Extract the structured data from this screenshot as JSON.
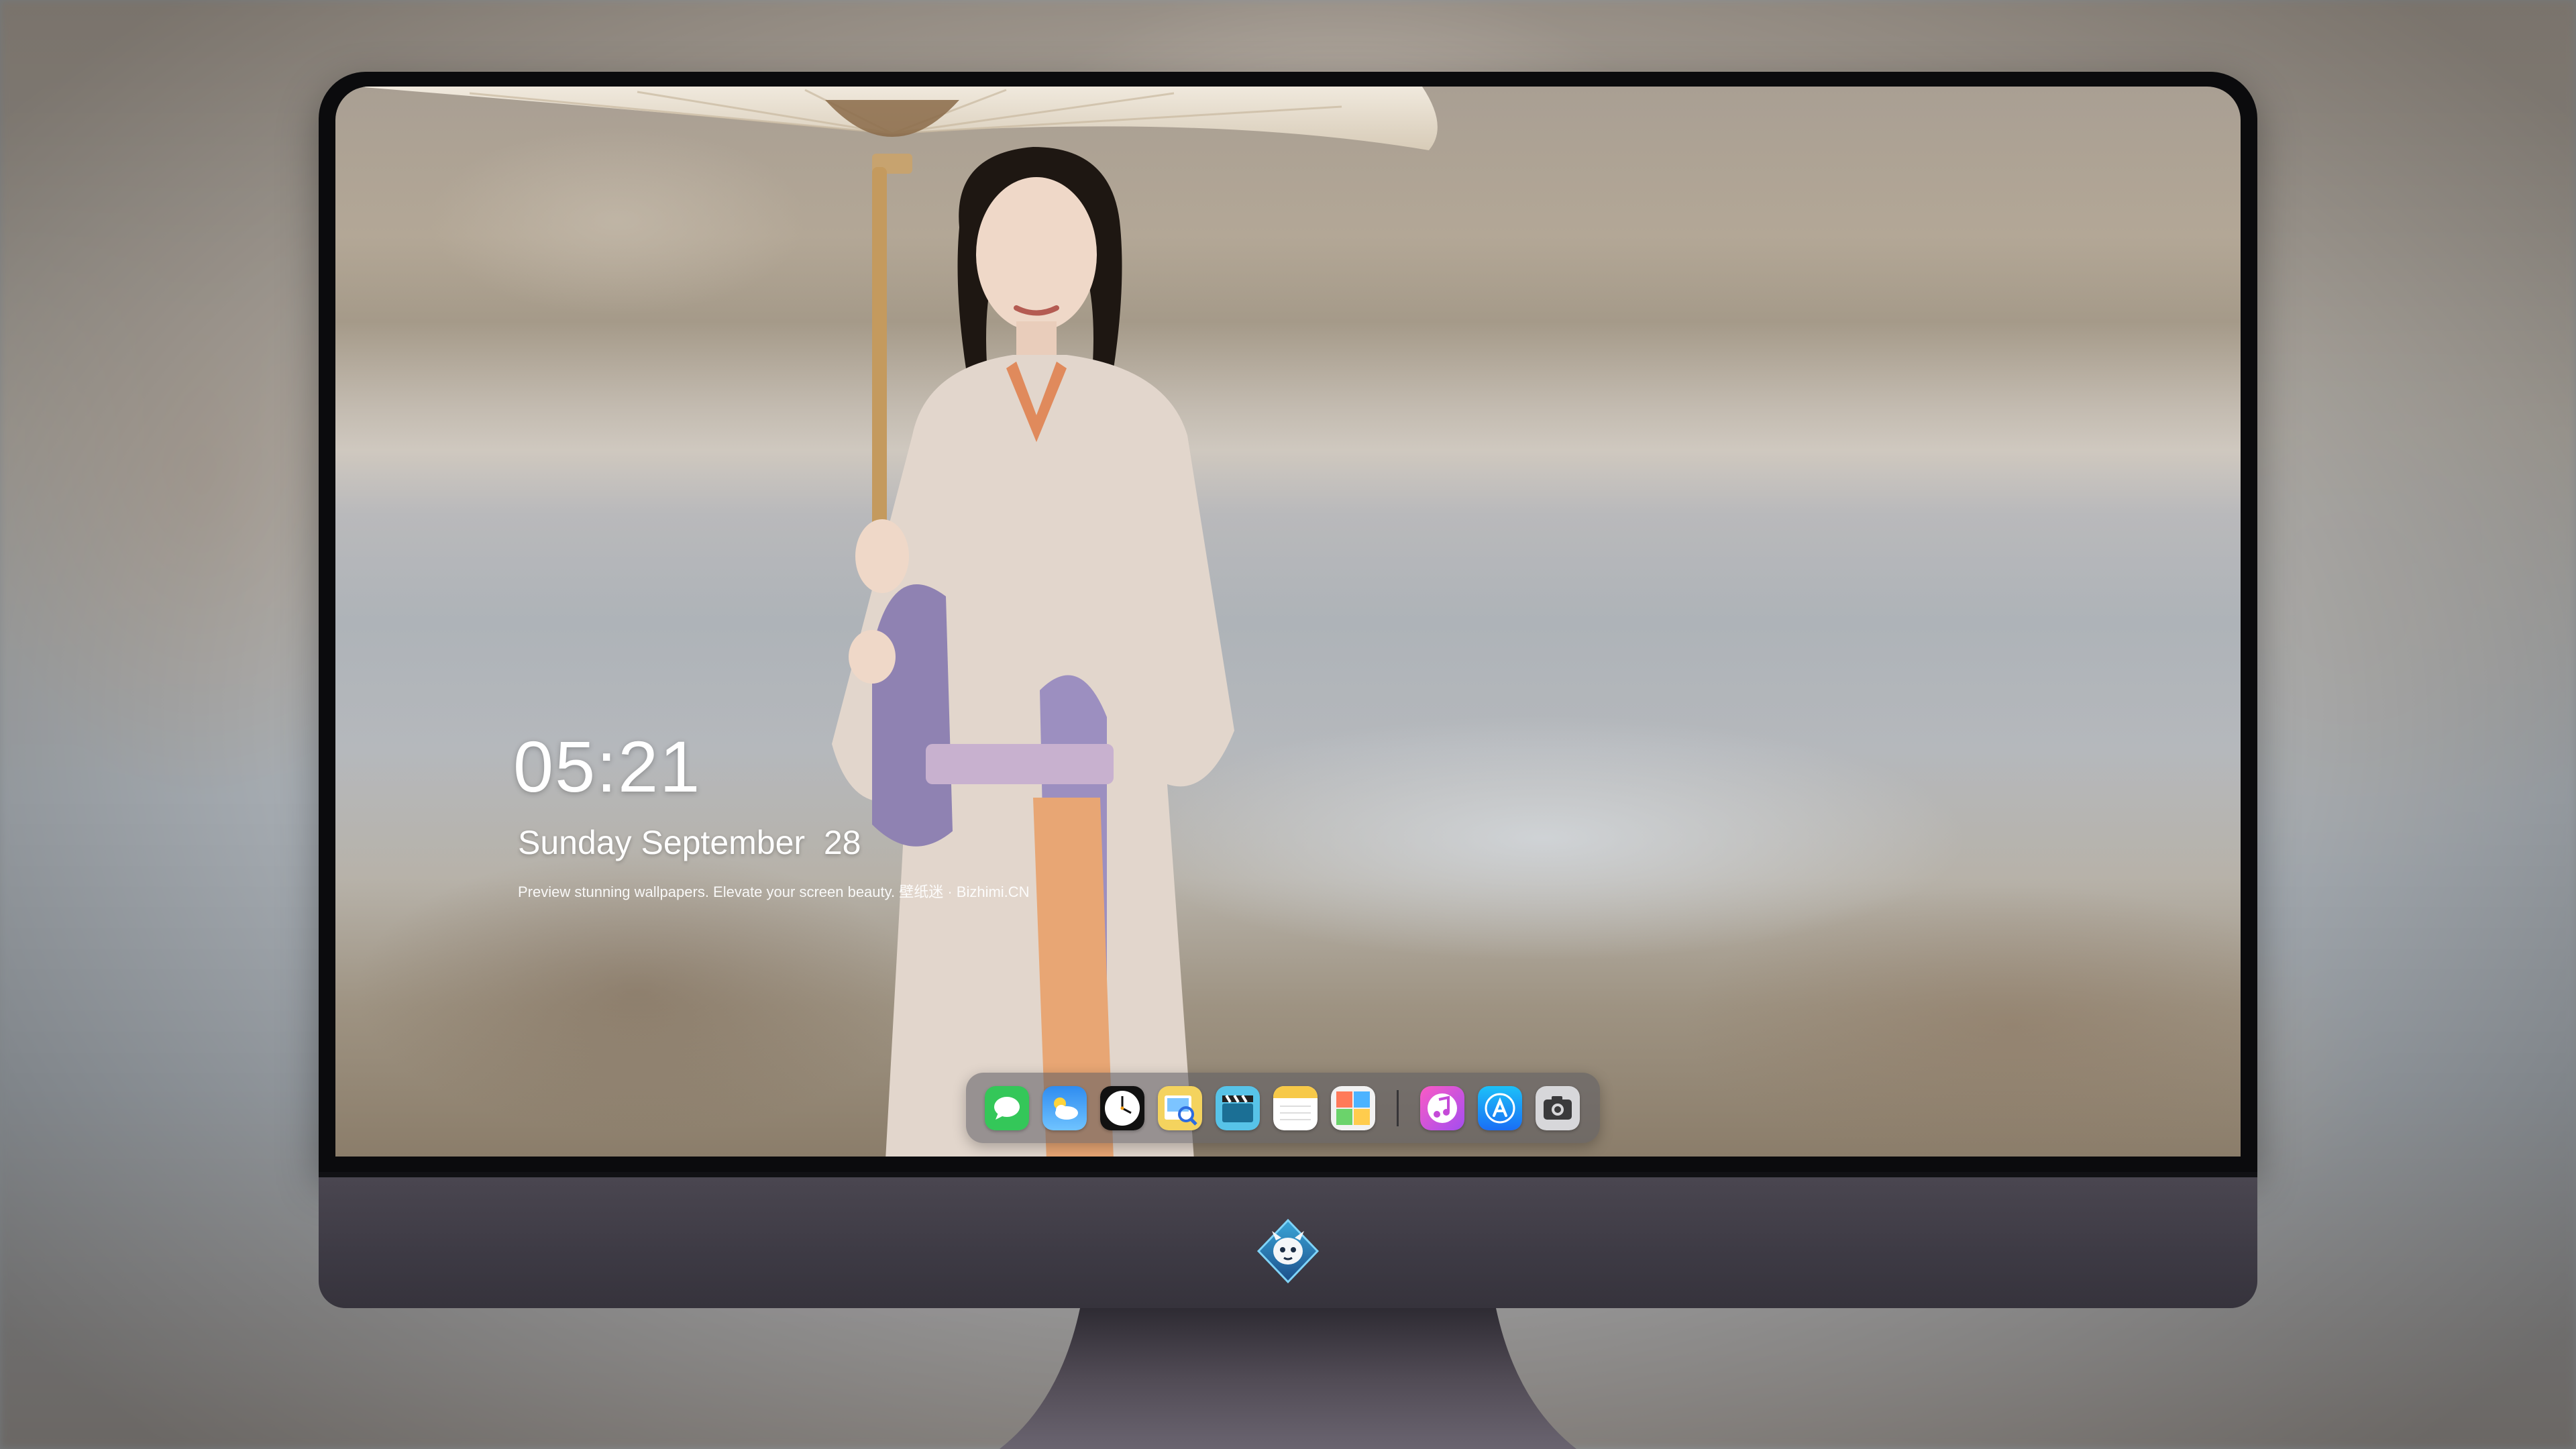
{
  "lockscreen": {
    "time": "05:21",
    "date": "Sunday September  28",
    "tagline": "Preview stunning wallpapers. Elevate your screen beauty. 壁纸迷 · Bizhimi.CN"
  },
  "dock": {
    "apps": [
      {
        "name": "Messages",
        "icon": "messages-icon"
      },
      {
        "name": "Weather",
        "icon": "weather-icon"
      },
      {
        "name": "Clock",
        "icon": "clock-icon"
      },
      {
        "name": "Preview",
        "icon": "preview-icon"
      },
      {
        "name": "Clips",
        "icon": "clapperboard-icon"
      },
      {
        "name": "Notes",
        "icon": "notes-icon"
      },
      {
        "name": "Photo Booth",
        "icon": "photo-grid-icon"
      },
      {
        "name": "Music",
        "icon": "music-icon"
      },
      {
        "name": "App Store",
        "icon": "app-store-icon"
      },
      {
        "name": "Camera",
        "icon": "camera-icon"
      }
    ]
  },
  "colors": {
    "bezel": "#0b0b0d",
    "chin": "#3d3a44",
    "clock_text": "#ffffff",
    "dock_bg": "rgba(90,90,96,0.55)"
  }
}
